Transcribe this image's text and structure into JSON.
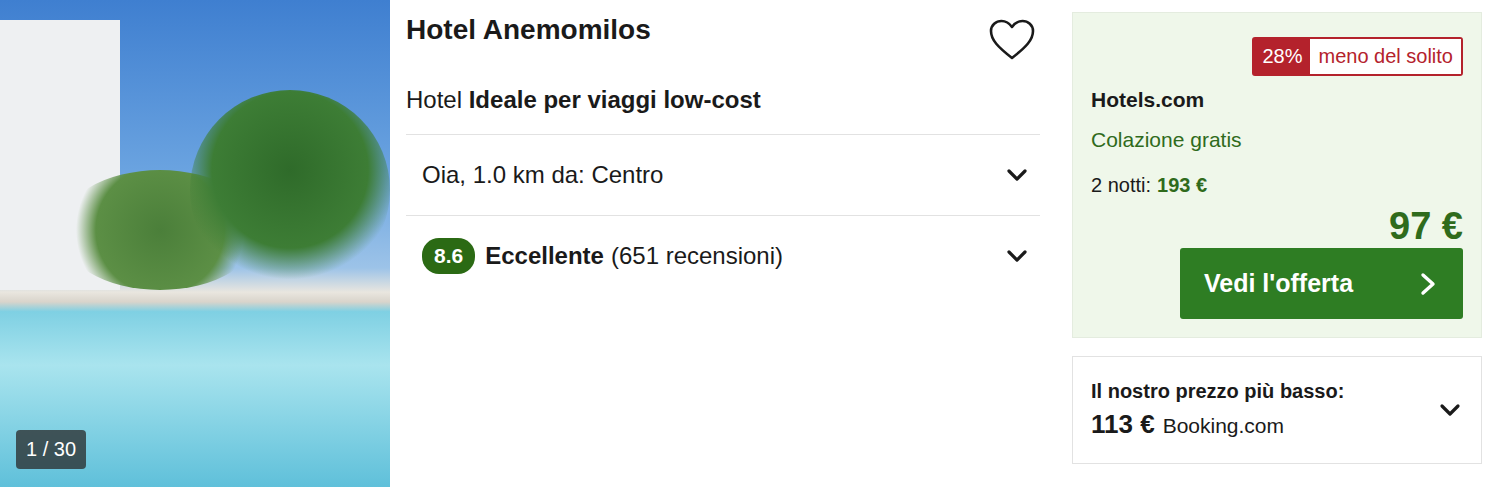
{
  "photo": {
    "counter": "1 / 30"
  },
  "hotel": {
    "name": "Hotel Anemomilos",
    "favorite": false,
    "type": "Hotel",
    "tag": "Ideale per viaggi low-cost"
  },
  "location": {
    "text": "Oia, 1.0 km da: Centro",
    "expanded": false
  },
  "rating": {
    "score": "8.6",
    "label": "Eccellente",
    "reviews": "(651 recensioni)",
    "expanded": false
  },
  "deal": {
    "discount": "28%",
    "discount_label": "meno del solito",
    "provider": "Hotels.com",
    "perk": "Colazione gratis",
    "total_label": "2 notti:",
    "total": "193 €",
    "price": "97 €",
    "button": "Vedi l'offerta"
  },
  "lowest": {
    "label": "Il nostro prezzo più basso:",
    "price": "113 €",
    "provider": "Booking.com",
    "expanded": false
  }
}
